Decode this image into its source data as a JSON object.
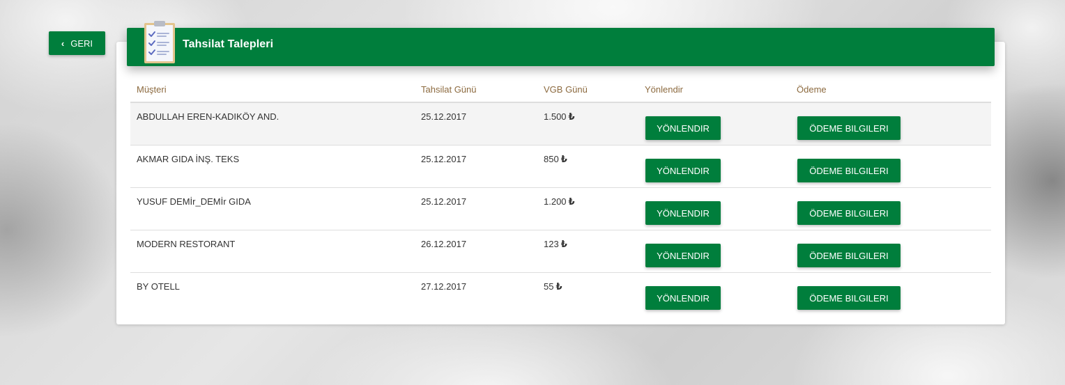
{
  "back_button": {
    "label": "GERI",
    "icon": "chevron-left-icon"
  },
  "header": {
    "title": "Tahsilat Talepleri",
    "icon": "clipboard-checklist-icon"
  },
  "columns": {
    "customer": "Müşteri",
    "collection_day": "Tahsilat Günü",
    "vgb_day": "VGB Günü",
    "route": "Yönlendir",
    "payment": "Ödeme"
  },
  "rows": [
    {
      "customer": "ABDULLAH EREN-KADIKÖY AND.",
      "collection_day": "25.12.2017",
      "amount": "1.500",
      "currency": "₺",
      "route_label": "YÖNLENDIR",
      "payment_label": "ÖDEME BILGILERI"
    },
    {
      "customer": "AKMAR GIDA İNŞ. TEKS",
      "collection_day": "25.12.2017",
      "amount": "850",
      "currency": "₺",
      "route_label": "YÖNLENDIR",
      "payment_label": "ÖDEME BILGILERI"
    },
    {
      "customer": "YUSUF DEMİr_DEMİr GIDA",
      "collection_day": "25.12.2017",
      "amount": "1.200",
      "currency": "₺",
      "route_label": "YÖNLENDIR",
      "payment_label": "ÖDEME BILGILERI"
    },
    {
      "customer": "MODERN RESTORANT",
      "collection_day": "26.12.2017",
      "amount": "123",
      "currency": "₺",
      "route_label": "YÖNLENDIR",
      "payment_label": "ÖDEME BILGILERI"
    },
    {
      "customer": "BY OTELL",
      "collection_day": "27.12.2017",
      "amount": "55",
      "currency": "₺",
      "route_label": "YÖNLENDIR",
      "payment_label": "ÖDEME BILGILERI"
    }
  ],
  "colors": {
    "brand_green": "#007e3c",
    "header_text": "#8c6a3f"
  }
}
